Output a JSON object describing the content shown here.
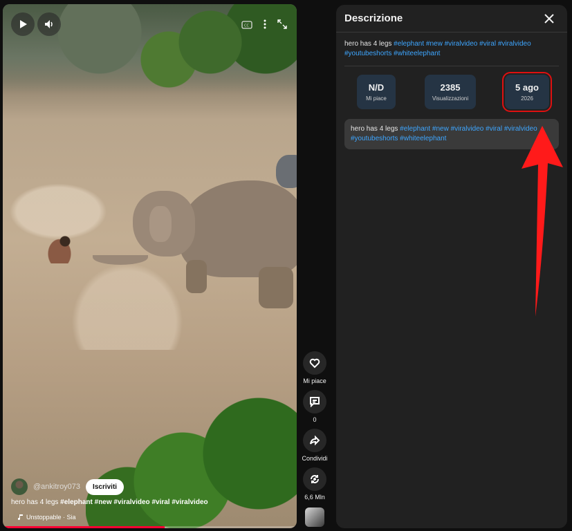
{
  "video": {
    "channel_handle": "@ankitroy073",
    "subscribe_label": "Iscriviti",
    "title_plain": "hero has 4 legs ",
    "title_tags": "#elephant #new #viralvideo #viral #viralvideo",
    "sound": "Unstoppable · Sia",
    "progress_fraction": 0.55,
    "icons": [
      "play-icon",
      "volume-icon",
      "captions-icon",
      "more-icon",
      "fullscreen-icon"
    ]
  },
  "actions": {
    "like_label": "Mi piace",
    "comments_count": "0",
    "share_label": "Condividi",
    "remix_count": "6,6 Mln"
  },
  "panel": {
    "title": "Descrizione",
    "description_plain": "hero has 4 legs ",
    "description_tags": "#elephant #new #viralvideo #viral #viralvideo #youtubeshorts #whiteelephant",
    "stats": {
      "likes_value": "N/D",
      "likes_label": "Mi piace",
      "views_value": "2385",
      "views_label": "Visualizzazioni",
      "date_value": "5 ago",
      "date_label": "2026"
    },
    "box_plain": "hero has 4 legs ",
    "box_tags": "#elephant #new #viralvideo #viral #viralvideo #youtubeshorts #whiteelephant"
  },
  "colors": {
    "link": "#3ea6ff",
    "highlight": "#e01010",
    "arrow": "#ff1a1a",
    "progress": "#ff0033"
  }
}
